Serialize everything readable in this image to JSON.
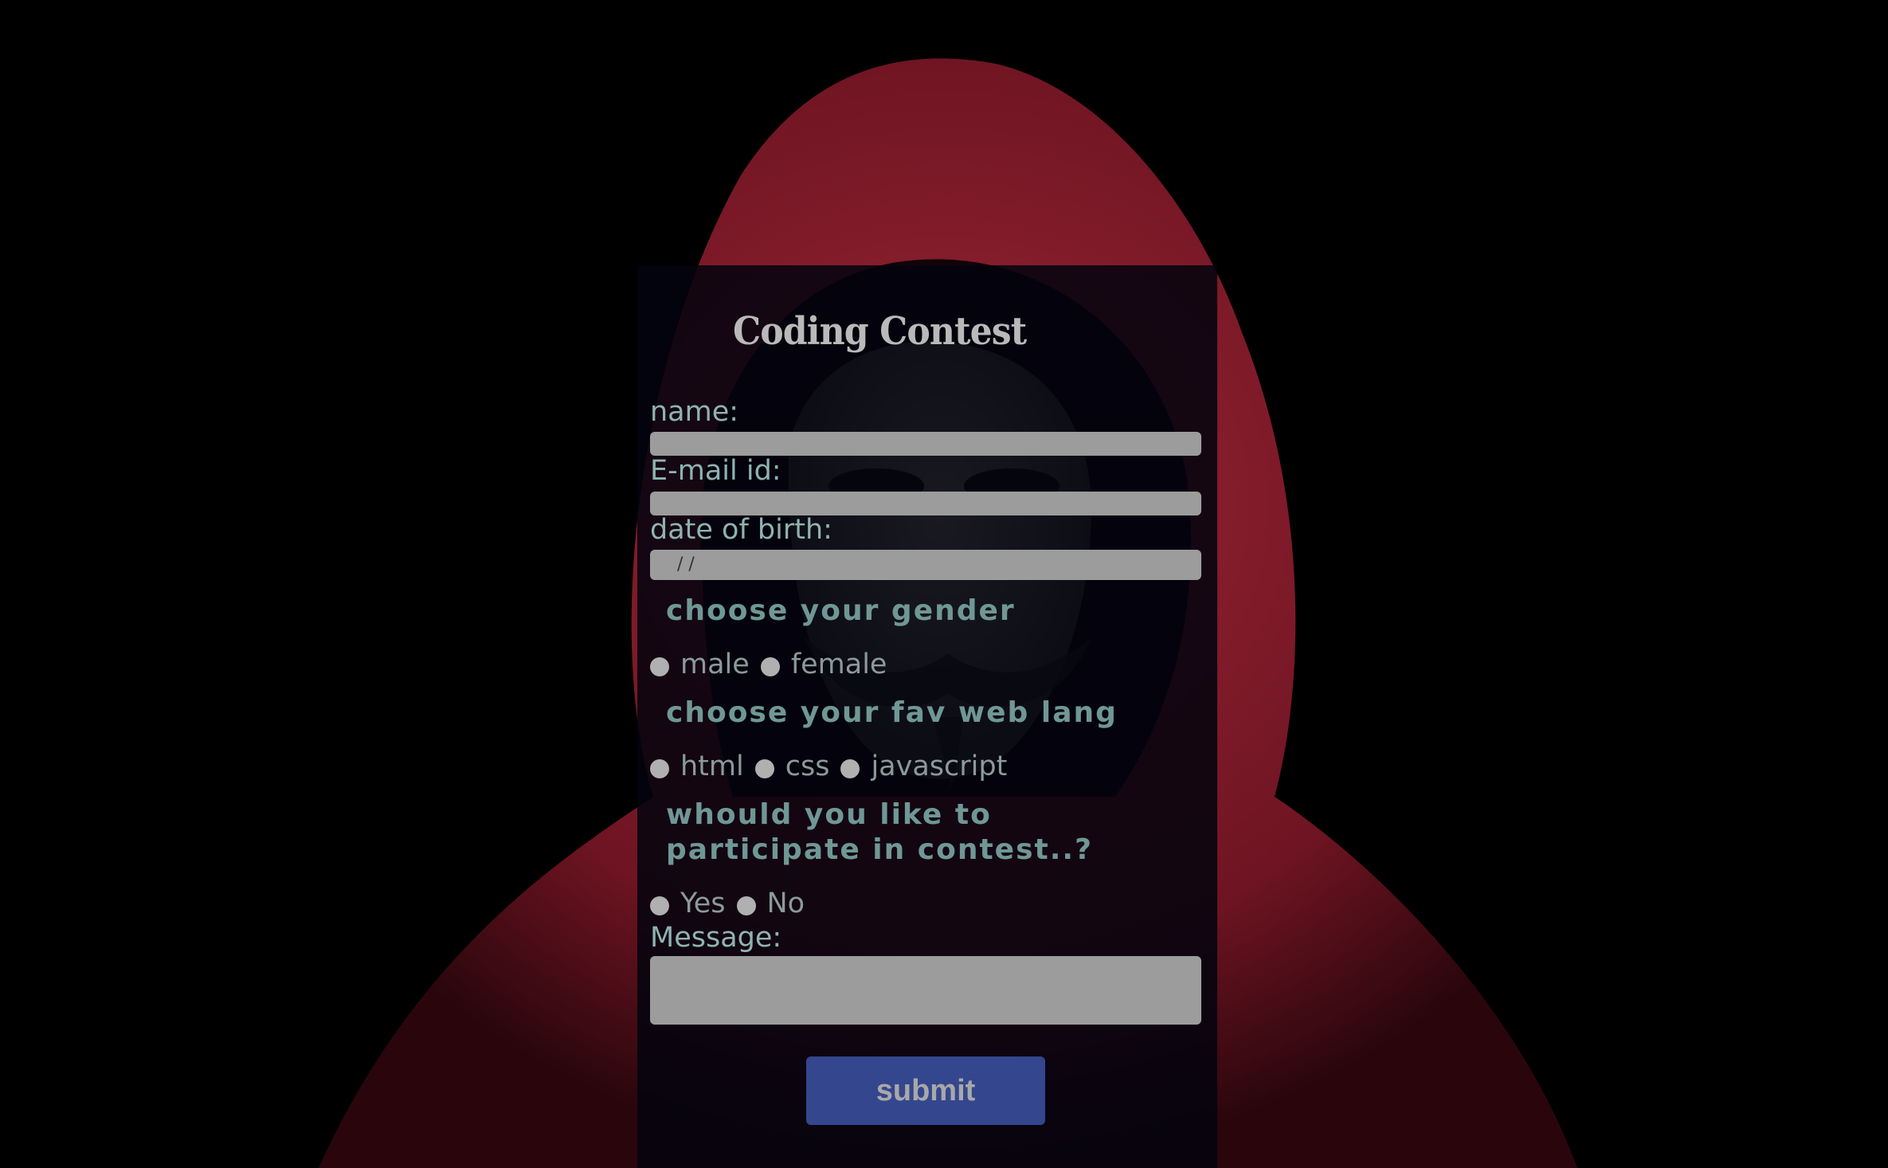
{
  "form": {
    "title": "Coding Contest",
    "name_label": "name:",
    "email_label": "E-mail id:",
    "dob_label": "date of birth:",
    "dob_placeholder": "/ /",
    "gender_title": "choose your gender",
    "gender_options": [
      "male",
      "female"
    ],
    "lang_title": "choose your fav web lang",
    "lang_options": [
      "html",
      "css",
      "javascript"
    ],
    "participate_title": "whould you like to participate in contest..?",
    "participate_options": [
      "Yes",
      "No"
    ],
    "message_label": "Message:",
    "submit_label": "submit"
  },
  "colors": {
    "page_background": "#000000",
    "card_background": "#02030e",
    "field_background": "#9c9c9c",
    "label_text": "#8fb3b2",
    "section_text": "#6f9796",
    "submit_background": "#34468e",
    "hood": "#8a1a2a"
  }
}
